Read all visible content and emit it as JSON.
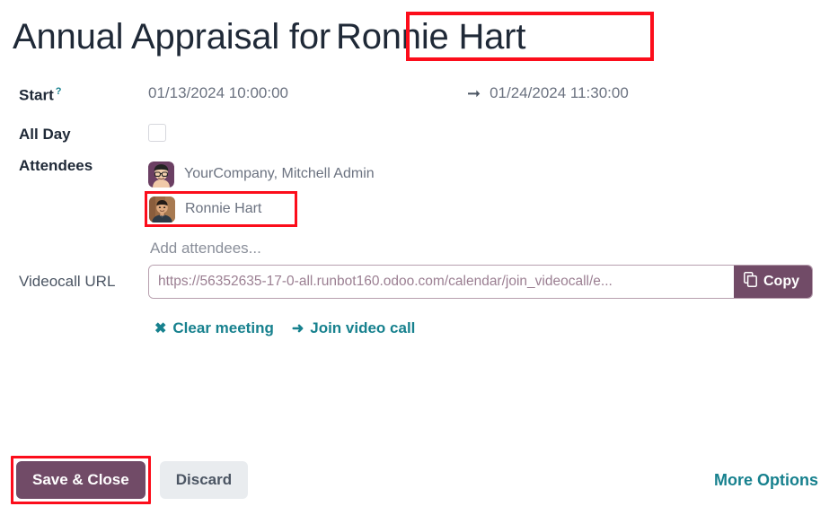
{
  "title": {
    "static_text": "Annual Appraisal for",
    "highlighted_name": "Ronnie Hart"
  },
  "fields": {
    "start": {
      "label": "Start",
      "hint_marker": "?",
      "start_value": "01/13/2024 10:00:00",
      "arrow_glyph": "➞",
      "end_value": "01/24/2024 11:30:00"
    },
    "all_day": {
      "label": "All Day",
      "checked": false
    },
    "attendees": {
      "label": "Attendees",
      "list": [
        {
          "name": "YourCompany, Mitchell Admin",
          "avatar": "avatar-mitchell-admin",
          "highlighted": false
        },
        {
          "name": "Ronnie Hart",
          "avatar": "avatar-ronnie-hart",
          "highlighted": true
        }
      ],
      "add_placeholder": "Add attendees..."
    },
    "videocall": {
      "label": "Videocall URL",
      "url_value": "https://56352635-17-0-all.runbot160.odoo.com/calendar/join_videocall/e...",
      "copy_label": "Copy",
      "copy_icon": "copy-icon"
    },
    "links": [
      {
        "icon": "close-x-icon",
        "glyph": "✖",
        "label": "Clear meeting",
        "name": "clear-meeting-link"
      },
      {
        "icon": "arrow-right-icon",
        "glyph": "➜",
        "label": "Join video call",
        "name": "join-video-call-link"
      }
    ]
  },
  "footer": {
    "save_label": "Save & Close",
    "discard_label": "Discard",
    "more_options_label": "More Options"
  },
  "colors": {
    "brand_purple": "#714B67",
    "teal_link": "#17818E",
    "annotation_red": "#FC0D1B",
    "label_dark": "#1F2937",
    "value_gray": "#6B7280"
  }
}
